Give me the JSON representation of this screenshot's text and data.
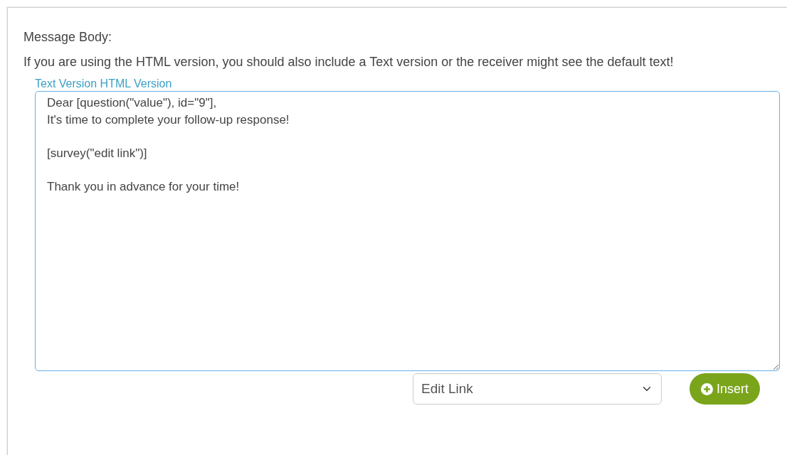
{
  "section": {
    "title": "Message Body:",
    "notice": "If you are using the HTML version, you should also include a Text version or the receiver might see the default text!"
  },
  "version_links": [
    {
      "label": "Text Version"
    },
    {
      "label": "HTML Version"
    }
  ],
  "message": {
    "value": "Dear [question(\"value\"), id=\"9\"],\nIt's time to complete your follow-up response!\n\n[survey(\"edit link\")]\n\nThank you in advance for your time!"
  },
  "insert_select": {
    "value": "Edit Link"
  },
  "insert_button": {
    "label": "Insert"
  }
}
